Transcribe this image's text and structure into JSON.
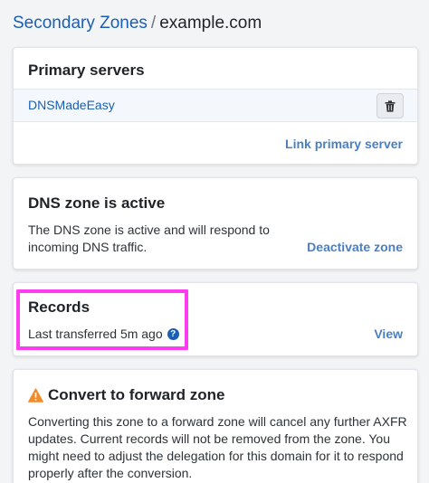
{
  "breadcrumb": {
    "parent": "Secondary Zones",
    "separator": "/",
    "current": "example.com"
  },
  "primary_servers": {
    "title": "Primary servers",
    "servers": [
      {
        "name": "DNSMadeEasy"
      }
    ],
    "delete_icon": "trash-icon",
    "link_label": "Link primary server"
  },
  "zone_status": {
    "title": "DNS zone is active",
    "description": "The DNS zone is active and will respond to incoming DNS traffic.",
    "action_label": "Deactivate zone"
  },
  "records": {
    "title": "Records",
    "last_transferred": "Last transferred 5m ago",
    "help_icon": "?",
    "view_label": "View"
  },
  "convert": {
    "icon": "warning-icon",
    "title": "Convert to forward zone",
    "description": "Converting this zone to a forward zone will cancel any further AXFR updates. Current records will not be removed from the zone. You might need to adjust the delegation for this domain for it to respond properly after the conversion."
  },
  "colors": {
    "link": "#1a5fb4",
    "action_link": "#4a7fc1",
    "highlight": "#ff3cf0",
    "warning": "#f08c2e"
  }
}
